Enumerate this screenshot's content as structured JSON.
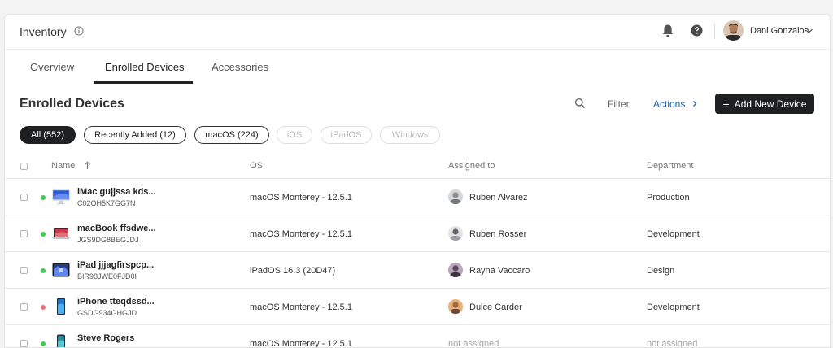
{
  "header": {
    "app_title": "Inventory",
    "user": {
      "name": "Dani Gonzalos"
    }
  },
  "tabs": [
    {
      "label": "Overview",
      "active": false
    },
    {
      "label": "Enrolled Devices",
      "active": true
    },
    {
      "label": "Accessories",
      "active": false
    }
  ],
  "section": {
    "title": "Enrolled Devices",
    "filter_label": "Filter",
    "actions_label": "Actions",
    "add_label": "Add New Device"
  },
  "chips": [
    {
      "label": "All (552)",
      "state": "active"
    },
    {
      "label": "Recently Added (12)",
      "state": "normal"
    },
    {
      "label": "macOS (224)",
      "state": "normal"
    },
    {
      "label": "iOS",
      "state": "disabled"
    },
    {
      "label": "iPadOS",
      "state": "disabled"
    },
    {
      "label": "Windows",
      "state": "disabled"
    }
  ],
  "table": {
    "columns": {
      "name": "Name",
      "os": "OS",
      "assigned": "Assigned to",
      "department": "Department"
    },
    "rows": [
      {
        "name": "iMac gujjssa kds...",
        "serial": "C02QH5K7GG7N",
        "status": "online",
        "device": "imac",
        "os": "macOS Monterey - 12.5.1",
        "assigned": "Ruben Alvarez",
        "department": "Production",
        "avatar_color": "#8a8f96"
      },
      {
        "name": "macBook ffsdwe...",
        "serial": "JGS9DG8BEGJDJ",
        "status": "online",
        "device": "macbook",
        "os": "macOS Monterey - 12.5.1",
        "assigned": "Ruben Rosser",
        "department": "Development",
        "avatar_color": "#6e747b"
      },
      {
        "name": "iPad jjjagfirspcp...",
        "serial": "BIR98JWE0FJD0I",
        "status": "online",
        "device": "ipad",
        "os": "iPadOS 16.3 (20D47)",
        "assigned": "Rayna Vaccaro",
        "department": "Design",
        "avatar_color": "#5b4a63"
      },
      {
        "name": "iPhone tteqdssd...",
        "serial": "GSDG934GHGJD",
        "status": "offline",
        "device": "iphone",
        "os": "macOS Monterey - 12.5.1",
        "assigned": "Dulce Carder",
        "department": "Development",
        "avatar_color": "#9a6a45"
      },
      {
        "name": "Steve Rogers",
        "serial": "",
        "status": "online",
        "device": "iphone",
        "os": "macOS Monterey - 12.5.1",
        "assigned": "not assigned",
        "department": "not assigned",
        "avatar_color": ""
      }
    ]
  },
  "colors": {
    "accent": "#1f5fa8",
    "primary_button": "#1e1f21",
    "status_online": "#3ccf4e",
    "status_offline": "#f07178"
  },
  "icons": {
    "info": "info-icon",
    "bell": "bell-icon",
    "help": "help-icon",
    "search": "search-icon",
    "sort": "sort-arrow-up-icon",
    "chevron": "chevron-right-icon"
  }
}
